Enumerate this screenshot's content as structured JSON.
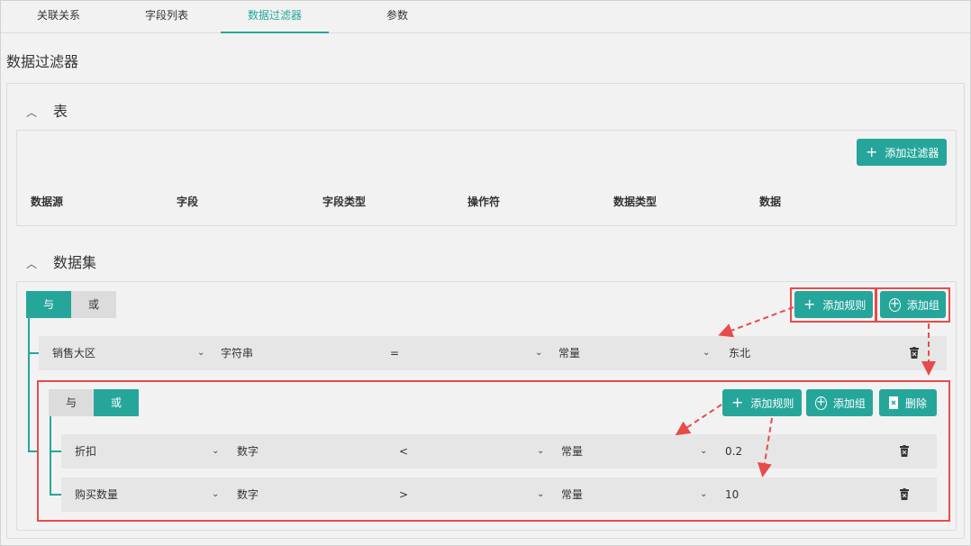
{
  "tabs": [
    {
      "label": "关联关系"
    },
    {
      "label": "字段列表"
    },
    {
      "label": "数据过滤器"
    },
    {
      "label": "参数"
    }
  ],
  "page_title": "数据过滤器",
  "table_section": {
    "title": "表",
    "add_filter_label": "添加过滤器",
    "columns": [
      "数据源",
      "字段",
      "字段类型",
      "操作符",
      "数据类型",
      "数据"
    ]
  },
  "dataset_section": {
    "title": "数据集",
    "logic": {
      "and": "与",
      "or": "或",
      "selected": "与"
    },
    "add_rule_label": "添加规则",
    "add_group_label": "添加组",
    "rule": {
      "field": "销售大区",
      "field_type": "字符串",
      "operator": "=",
      "data_type": "常量",
      "value": "东北"
    },
    "group": {
      "logic": {
        "and": "与",
        "or": "或",
        "selected": "或"
      },
      "add_rule_label": "添加规则",
      "add_group_label": "添加组",
      "delete_label": "删除",
      "rules": [
        {
          "field": "折扣",
          "field_type": "数字",
          "operator": "<",
          "data_type": "常量",
          "value": "0.2"
        },
        {
          "field": "购买数量",
          "field_type": "数字",
          "operator": ">",
          "data_type": "常量",
          "value": "10"
        }
      ]
    }
  },
  "colors": {
    "accent": "#26a69a",
    "annotation": "#e84b4b"
  }
}
